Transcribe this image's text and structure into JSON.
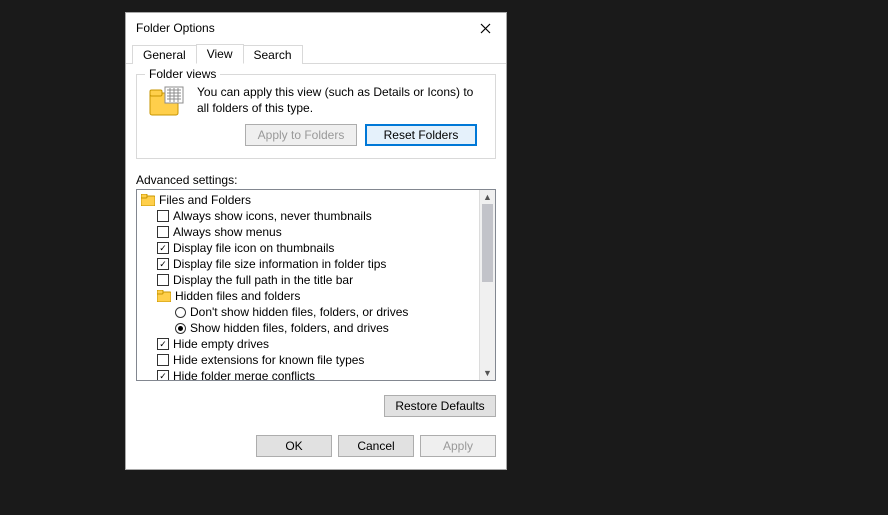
{
  "window": {
    "title": "Folder Options"
  },
  "tabs": {
    "general": "General",
    "view": "View",
    "search": "Search"
  },
  "folderViews": {
    "legend": "Folder views",
    "text": "You can apply this view (such as Details or Icons) to all folders of this type.",
    "applyBtn": "Apply to Folders",
    "resetBtn": "Reset Folders"
  },
  "advanced": {
    "label": "Advanced settings:",
    "groupFilesFolders": "Files and Folders",
    "optAlwaysIcons": "Always show icons, never thumbnails",
    "optAlwaysMenus": "Always show menus",
    "optDisplayIconThumb": "Display file icon on thumbnails",
    "optDisplayFileSize": "Display file size information in folder tips",
    "optDisplayFullPath": "Display the full path in the title bar",
    "groupHidden": "Hidden files and folders",
    "optDontShowHidden": "Don't show hidden files, folders, or drives",
    "optShowHidden": "Show hidden files, folders, and drives",
    "optHideEmpty": "Hide empty drives",
    "optHideExtensions": "Hide extensions for known file types",
    "optHideMerge": "Hide folder merge conflicts"
  },
  "buttons": {
    "restoreDefaults": "Restore Defaults",
    "ok": "OK",
    "cancel": "Cancel",
    "apply": "Apply"
  }
}
